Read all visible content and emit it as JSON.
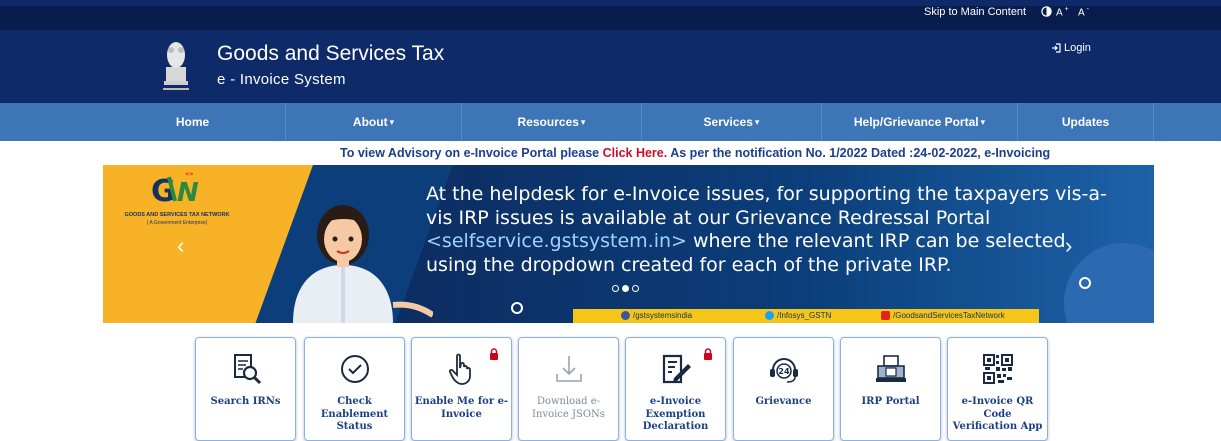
{
  "topbar": {
    "skip_link": "Skip to Main Content",
    "font_increase": "A",
    "font_increase_sup": "+",
    "font_decrease": "A",
    "font_decrease_sup": "-"
  },
  "header": {
    "title": "Goods and Services Tax",
    "subtitle": "e - Invoice System",
    "login_label": "Login"
  },
  "nav": {
    "items": [
      {
        "label": "Home",
        "dropdown": false
      },
      {
        "label": "About",
        "dropdown": true
      },
      {
        "label": "Resources",
        "dropdown": true
      },
      {
        "label": "Services",
        "dropdown": true
      },
      {
        "label": "Help/Grievance Portal",
        "dropdown": true
      },
      {
        "label": "Updates",
        "dropdown": false
      }
    ],
    "caret": "▾"
  },
  "ticker": {
    "pre": "To view Advisory on e-Invoice Portal please ",
    "link": "Click Here.",
    "post": " As per the notification No. 1/2022 Dated :24-02-2022, e-Invoicing"
  },
  "banner": {
    "org_name": "GOODS AND SERVICES TAX NETWORK",
    "org_sub": "( A Government Enterprise)",
    "text_part1": "At the helpdesk for e-Invoice issues, for supporting the taxpayers vis-a-vis IRP issues is available at our Grievance Redressal Portal ",
    "text_link": "<selfservice.gstsystem.in>",
    "text_part2": " where the relevant IRP can be selected using the dropdown created for each of the private IRP.",
    "prev_arrow": "‹",
    "next_arrow": "›",
    "social": {
      "facebook": "/gstsystemsindia",
      "twitter": "/Infosys_GSTN",
      "youtube": "/GoodsandServicesTaxNetwork"
    },
    "colors": {
      "accent": "#f7b227",
      "dark_blue": "#0b3e7a"
    }
  },
  "tiles": [
    {
      "label": "Search IRNs",
      "icon": "search-document-icon",
      "locked": false,
      "disabled": false
    },
    {
      "label": "Check Enablement Status",
      "icon": "check-circle-icon",
      "locked": false,
      "disabled": false
    },
    {
      "label": "Enable Me for e-Invoice",
      "icon": "hand-pointer-icon",
      "locked": true,
      "disabled": false
    },
    {
      "label": "Download e-Invoice JSONs",
      "icon": "download-icon",
      "locked": false,
      "disabled": true
    },
    {
      "label": "e-Invoice Exemption Declaration",
      "icon": "edit-document-icon",
      "locked": true,
      "disabled": false
    },
    {
      "label": "Grievance",
      "icon": "support-24-icon",
      "locked": false,
      "disabled": false
    },
    {
      "label": "IRP Portal",
      "icon": "portal-computer-icon",
      "locked": false,
      "disabled": false
    },
    {
      "label": "e-Invoice QR Code Verification App",
      "icon": "qr-code-icon",
      "locked": false,
      "disabled": false
    }
  ],
  "colors": {
    "header_bg": "#0f2a68",
    "nav_bg": "#3e75b6",
    "ticker_text": "#1b3e8f",
    "ticker_link": "#c8102e"
  }
}
